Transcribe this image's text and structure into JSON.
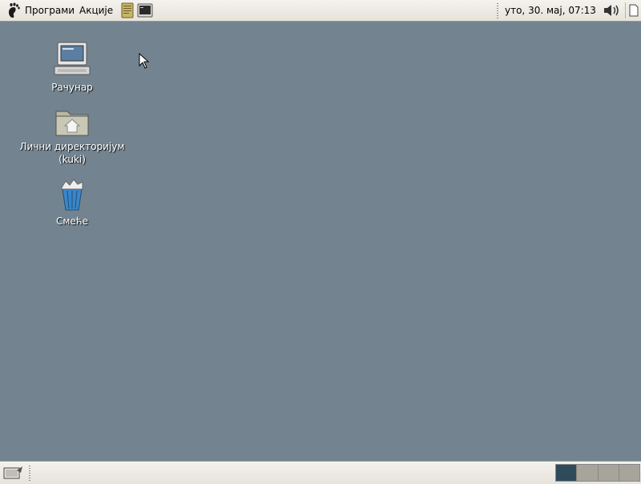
{
  "top_panel": {
    "menus": {
      "programs": "Програми",
      "actions": "Акције"
    },
    "launchers": [
      "text-editor-icon",
      "terminal-icon"
    ],
    "clock": "уто, 30. мај, 07:13",
    "icons": {
      "logo": "gnome-foot-icon",
      "volume": "volume-icon",
      "show_desktop": "show-desktop-icon"
    }
  },
  "desktop": {
    "background_color": "#738490",
    "icons": [
      {
        "label": "Рачунар",
        "icon": "computer-icon"
      },
      {
        "label_line1": "Лични директоријум",
        "label_line2": "(kuki)",
        "icon": "home-folder-icon"
      },
      {
        "label": "Смеће",
        "icon": "trash-icon"
      }
    ]
  },
  "bottom_panel": {
    "workspace_count": 4,
    "active_workspace": 1,
    "workspace_active_color": "#2e4b5c"
  }
}
